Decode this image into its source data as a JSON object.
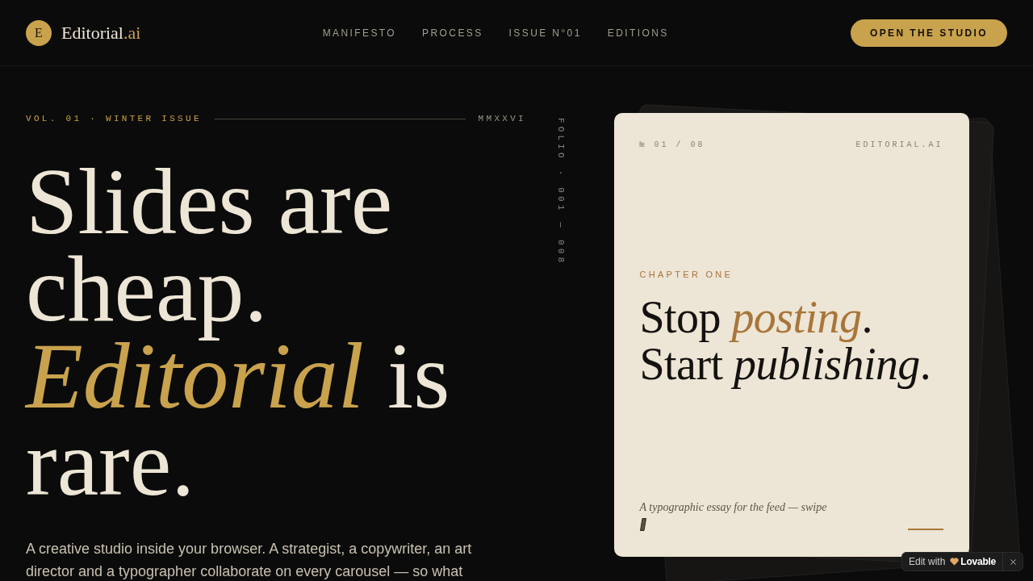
{
  "header": {
    "logo": {
      "letter": "E",
      "name": "Editorial",
      "suffix": ".ai"
    },
    "nav": [
      "MANIFESTO",
      "PROCESS",
      "ISSUE N°01",
      "EDITIONS"
    ],
    "cta": "OPEN THE STUDIO"
  },
  "hero": {
    "kicker": "VOL. 01 · WINTER ISSUE",
    "year": "MMXXVI",
    "headline": [
      [
        {
          "text": "Slides are",
          "kind": "plain"
        }
      ],
      [
        {
          "text": "cheap.",
          "kind": "plain"
        }
      ],
      [
        {
          "text": "Editorial",
          "kind": "accent"
        },
        {
          "text": " is",
          "kind": "plain"
        }
      ],
      [
        {
          "text": "rare.",
          "kind": "plain"
        }
      ]
    ],
    "body": "A creative studio inside your browser. A strategist, a copywriter, an art director and a typographer collaborate on every carousel — so what"
  },
  "folio": "FOLIO · 001 — 008",
  "card": {
    "number": "№ 01 / 08",
    "brand": "EDITORIAL.AI",
    "chapter": "CHAPTER ONE",
    "headline": [
      [
        {
          "text": "Stop ",
          "kind": "plain"
        },
        {
          "text": "posting",
          "kind": "accent"
        },
        {
          "text": ".",
          "kind": "plain"
        }
      ],
      [
        {
          "text": "Start ",
          "kind": "plain"
        },
        {
          "text": "publishing",
          "kind": "italic"
        },
        {
          "text": ".",
          "kind": "plain"
        }
      ]
    ],
    "caption": "A typographic essay for the feed — swipe"
  },
  "edit_badge": {
    "label": "Edit with",
    "brand": "Lovable"
  }
}
